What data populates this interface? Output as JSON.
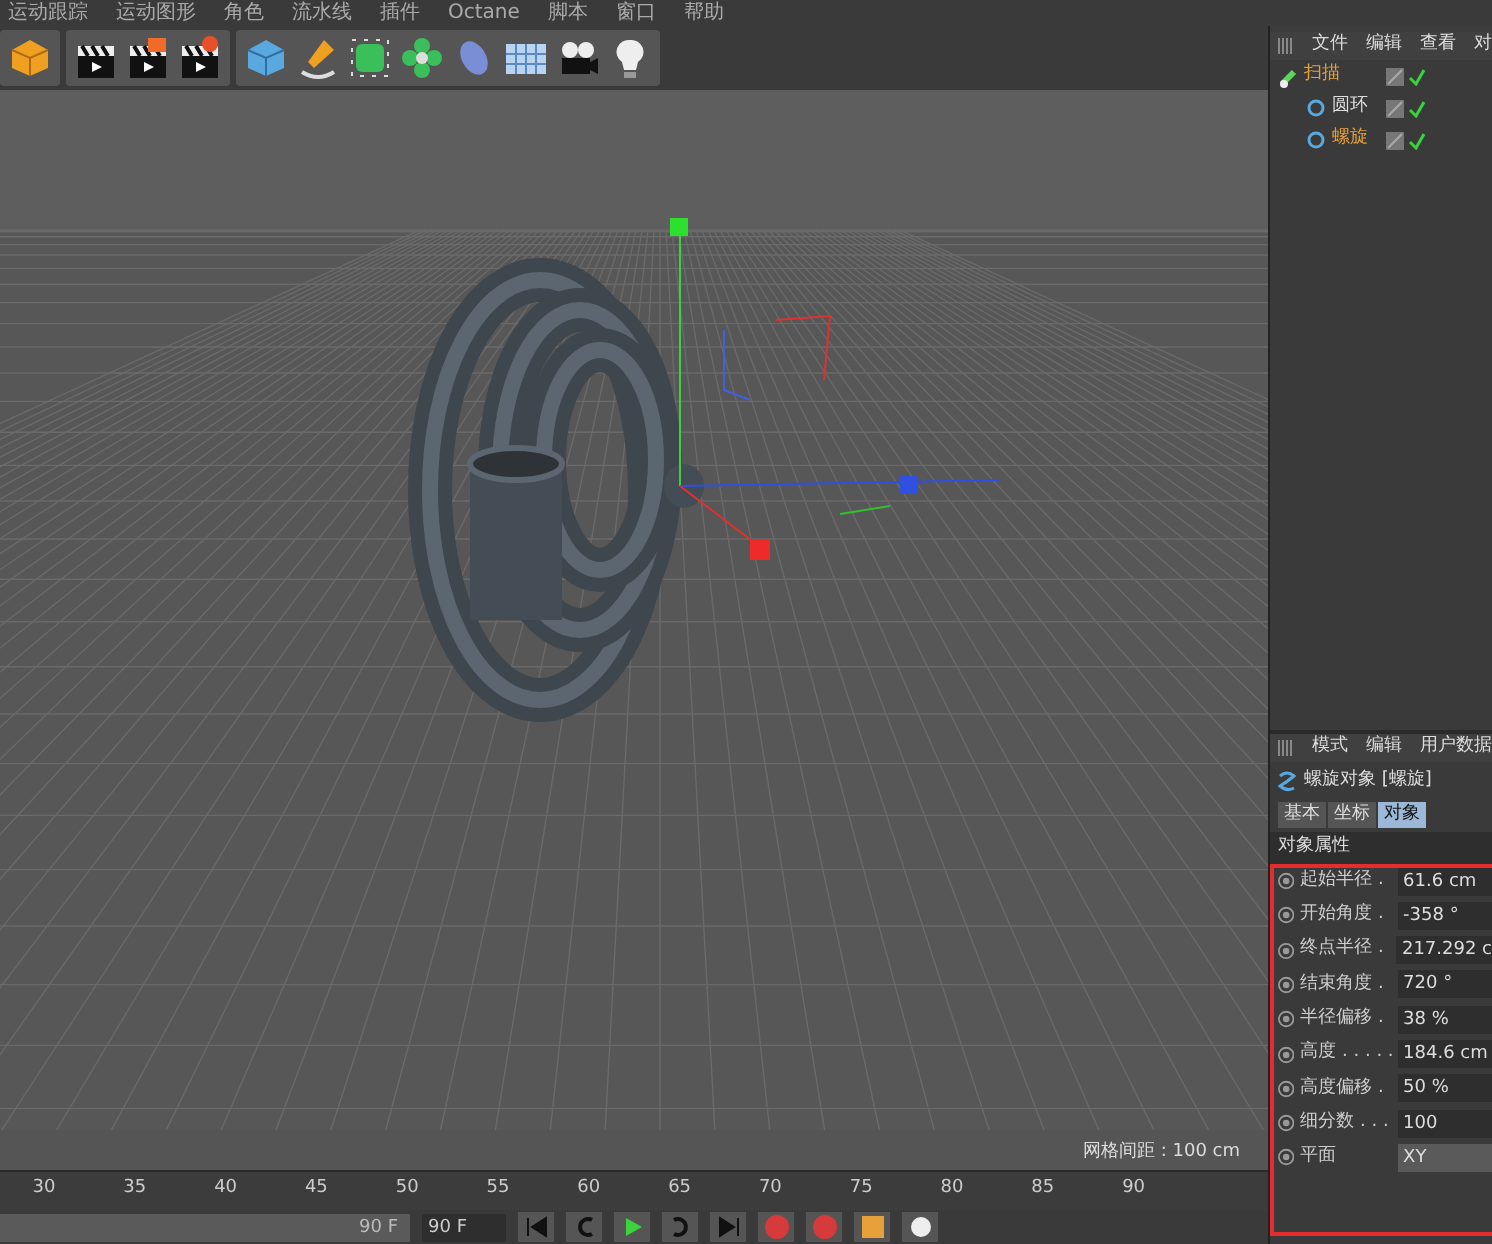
{
  "menu_bar": {
    "items": [
      "运动跟踪",
      "运动图形",
      "角色",
      "流水线",
      "插件",
      "Octane",
      "脚本",
      "窗口",
      "帮助"
    ]
  },
  "viewport": {
    "grid_label": "网格间距 : 100 cm"
  },
  "object_manager": {
    "menu": [
      "文件",
      "编辑",
      "查看",
      "对"
    ],
    "tree": [
      {
        "name": "扫描",
        "selected": true,
        "children": [
          {
            "name": "圆环",
            "selected": false
          },
          {
            "name": "螺旋",
            "selected": true
          }
        ]
      }
    ]
  },
  "attribute_manager": {
    "menu": [
      "模式",
      "编辑",
      "用户数据"
    ],
    "title": "螺旋对象 [螺旋]",
    "tabs": [
      {
        "label": "基本",
        "selected": false
      },
      {
        "label": "坐标",
        "selected": false
      },
      {
        "label": "对象",
        "selected": true
      }
    ],
    "section": "对象属性",
    "properties": [
      {
        "label": "起始半径 .",
        "value": "61.6 cm",
        "kind": "number"
      },
      {
        "label": "开始角度 .",
        "value": "-358 °",
        "kind": "number"
      },
      {
        "label": "终点半径 .",
        "value": "217.292 c",
        "kind": "number"
      },
      {
        "label": "结束角度 .",
        "value": "720 °",
        "kind": "number"
      },
      {
        "label": "半径偏移 .",
        "value": "38 %",
        "kind": "number"
      },
      {
        "label": "高度 . . . . .",
        "value": "184.6 cm",
        "kind": "number"
      },
      {
        "label": "高度偏移 .",
        "value": "50 %",
        "kind": "number"
      },
      {
        "label": "细分数 . . .",
        "value": "100",
        "kind": "number"
      },
      {
        "label": "平面",
        "value": "XY",
        "kind": "dropdown"
      }
    ]
  },
  "timeline": {
    "ticks": [
      "30",
      "35",
      "40",
      "45",
      "50",
      "55",
      "60",
      "65",
      "70",
      "75",
      "80",
      "85",
      "90"
    ]
  },
  "playback": {
    "range_slider": {
      "label": "90 F",
      "level": 1
    },
    "current_field": "90 F"
  }
}
